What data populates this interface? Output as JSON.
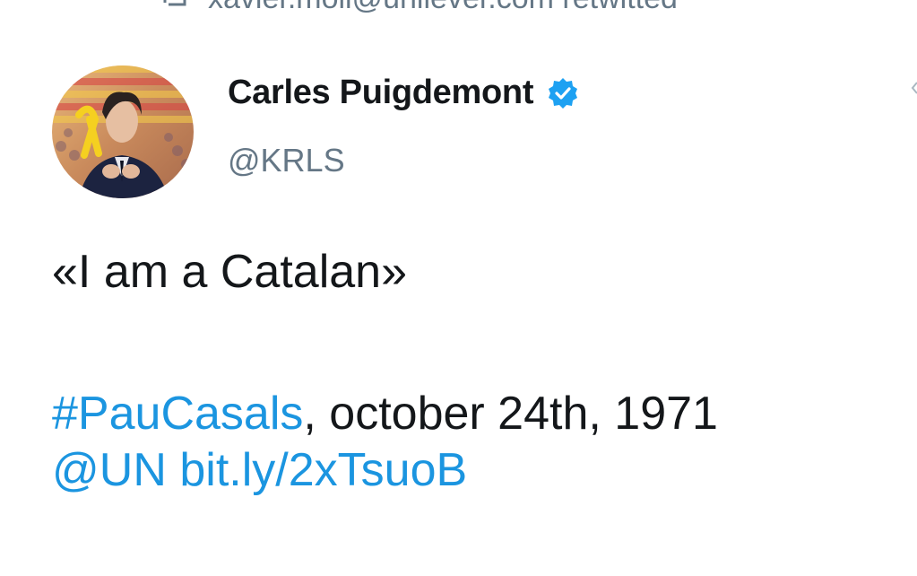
{
  "retweet": {
    "text": "xavier.moll@unilever.com retwitted",
    "icon": "retweet-icon"
  },
  "author": {
    "display_name": "Carles Puigdemont",
    "handle": "@KRLS",
    "verified": true,
    "verified_icon": "verified-badge-icon"
  },
  "tweet": {
    "quote": "«I am a Catalan»",
    "hashtag": "#PauCasals",
    "date_text": ", october 24th, 1971",
    "mention": "@UN",
    "url": "bit.ly/2xTsuoB"
  },
  "colors": {
    "link": "#1b95e0",
    "text": "#14171a",
    "muted": "#657786",
    "verified": "#1da1f2"
  }
}
